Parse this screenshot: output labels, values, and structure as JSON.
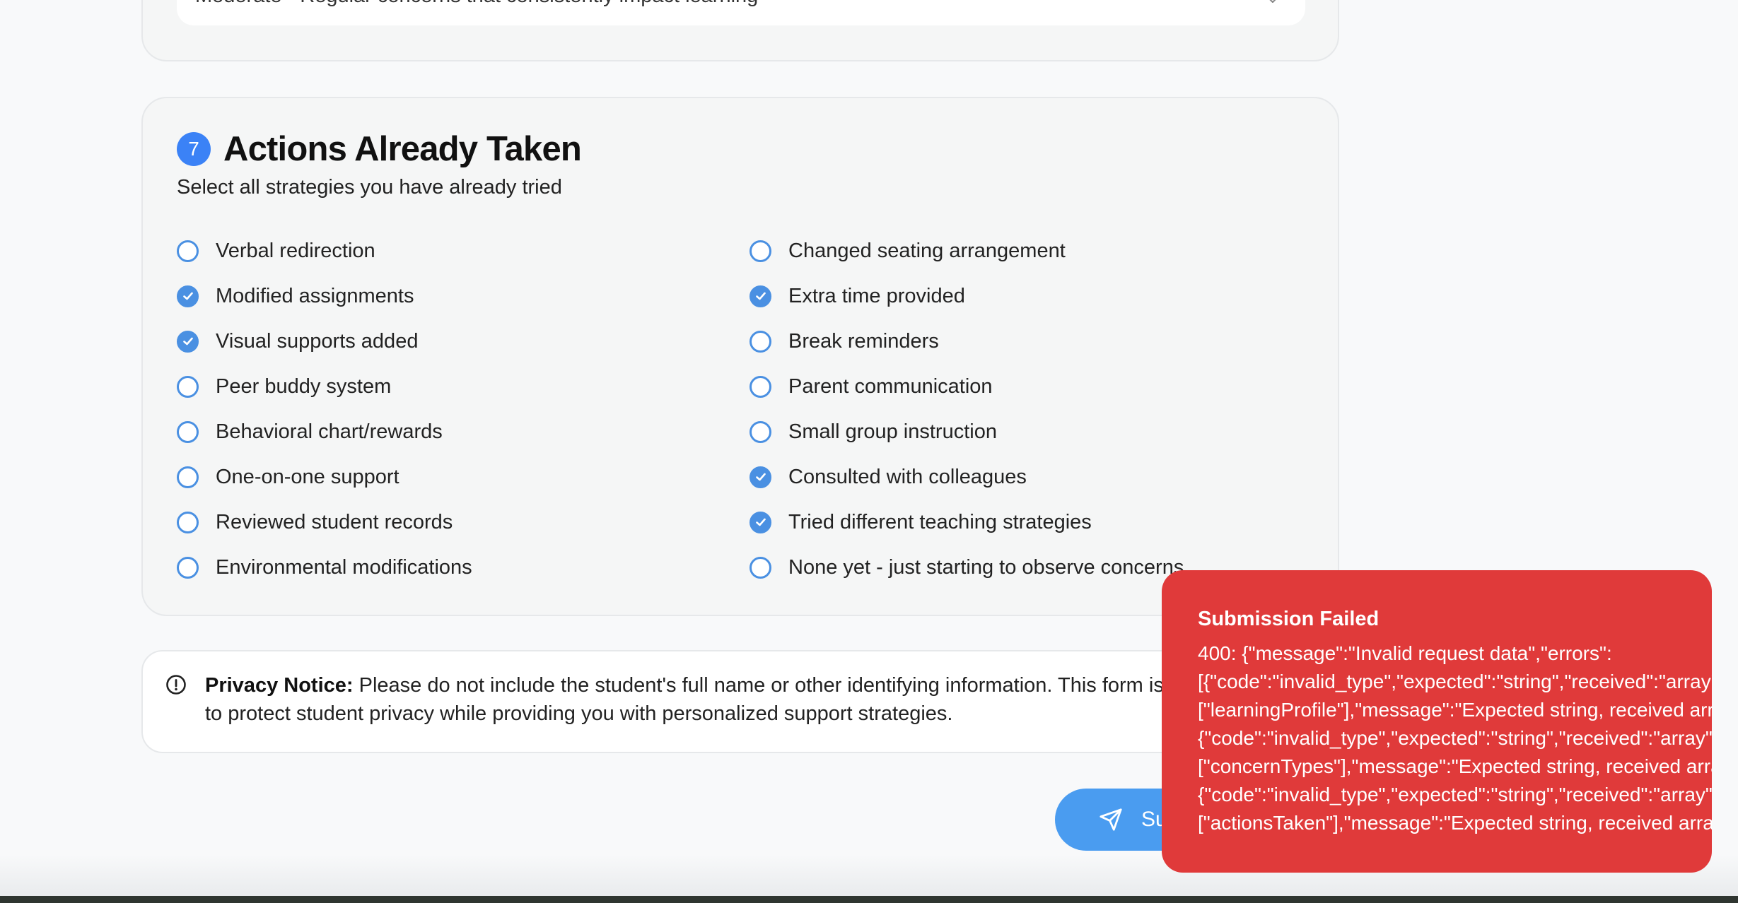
{
  "severity": {
    "selected_value": "Moderate - Regular concerns that consistently impact learning",
    "chevron": "chevron-down-icon"
  },
  "section7": {
    "number": "7",
    "title": "Actions Already Taken",
    "subtitle": "Select all strategies you have already tried",
    "left_options": [
      {
        "label": "Verbal redirection",
        "checked": false
      },
      {
        "label": "Modified assignments",
        "checked": true
      },
      {
        "label": "Visual supports added",
        "checked": true
      },
      {
        "label": "Peer buddy system",
        "checked": false
      },
      {
        "label": "Behavioral chart/rewards",
        "checked": false
      },
      {
        "label": "One-on-one support",
        "checked": false
      },
      {
        "label": "Reviewed student records",
        "checked": false
      },
      {
        "label": "Environmental modifications",
        "checked": false
      }
    ],
    "right_options": [
      {
        "label": "Changed seating arrangement",
        "checked": false
      },
      {
        "label": "Extra time provided",
        "checked": true
      },
      {
        "label": "Break reminders",
        "checked": false
      },
      {
        "label": "Parent communication",
        "checked": false
      },
      {
        "label": "Small group instruction",
        "checked": false
      },
      {
        "label": "Consulted with colleagues",
        "checked": true
      },
      {
        "label": "Tried different teaching strategies",
        "checked": true
      },
      {
        "label": "None yet - just starting to observe concerns",
        "checked": false
      }
    ]
  },
  "privacy": {
    "icon": "info-icon",
    "label": "Privacy Notice:",
    "text": " Please do not include the student's full name or other identifying information. This form is designed to protect student privacy while providing you with personalized support strategies."
  },
  "submit": {
    "icon": "send-icon",
    "label": "Submit"
  },
  "toast": {
    "title": "Submission Failed",
    "lines": [
      "400: {\"message\":\"Invalid request data\",\"errors\":",
      "[{\"code\":\"invalid_type\",\"expected\":\"string\",\"received\":\"array\",\"path\":",
      "[\"learningProfile\"],\"message\":\"Expected string, received array\"},",
      "{\"code\":\"invalid_type\",\"expected\":\"string\",\"received\":\"array\",\"path\":",
      "[\"concernTypes\"],\"message\":\"Expected string, received array\"},",
      "{\"code\":\"invalid_type\",\"expected\":\"string\",\"received\":\"array\",\"path\":",
      "[\"actionsTaken\"],\"message\":\"Expected string, received array\"}]}"
    ]
  },
  "colors": {
    "accent": "#4a90e2",
    "badge": "#3b82f6",
    "toast_bg": "#e03a3a",
    "button_bg": "#4a9cf0"
  }
}
